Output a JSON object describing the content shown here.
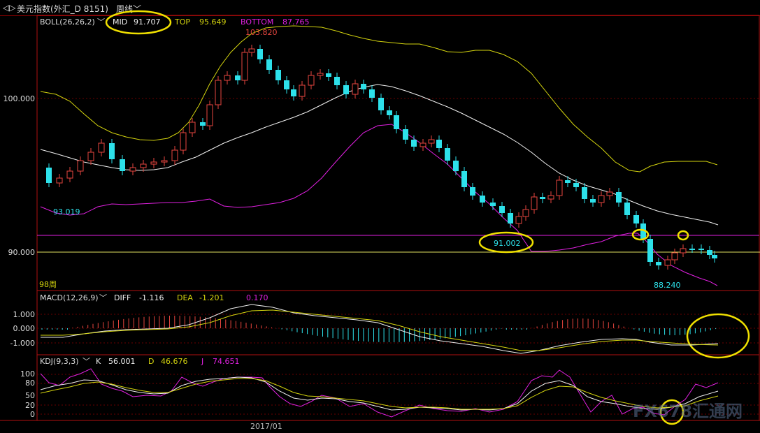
{
  "window": {
    "icon": "back-forward-icon",
    "instrument": "美元指数(外汇_D 8151)",
    "period": "周线"
  },
  "colors": {
    "up": "#e8463f",
    "down": "#2de1ea",
    "mid": "#f0f0f0",
    "top": "#d4d40e",
    "bottom": "#e020e0",
    "grid": "#7a0000",
    "axis": "#b01010"
  },
  "boll_panel": {
    "indicator": "BOLL(26,26,2)",
    "mid_label": "MID",
    "mid_value": "91.707",
    "top_label": "TOP",
    "top_value": "95.649",
    "bottom_label": "BOTTOM",
    "bottom_value": "87.765",
    "y_ticks": [
      "100.000",
      "90.000"
    ],
    "annotations": {
      "high": "103.820",
      "bottom_start": "93.019",
      "low_2017": "91.002",
      "low_recent": "88.240"
    },
    "bar_count": "98周"
  },
  "macd_panel": {
    "indicator": "MACD(12,26,9)",
    "diff_label": "DIFF",
    "diff_value": "-1.116",
    "dea_label": "DEA",
    "dea_value": "-1.201",
    "macd_value": "0.170",
    "y_ticks": [
      "1.000",
      "0.000",
      "-1.000"
    ]
  },
  "kdj_panel": {
    "indicator": "KDJ(9,3,3)",
    "k_label": "K",
    "k_value": "56.001",
    "d_label": "D",
    "d_value": "46.676",
    "j_label": "J",
    "j_value": "74.651",
    "y_ticks": [
      "100",
      "80",
      "50",
      "20",
      "0"
    ]
  },
  "x_axis": {
    "label": "2017/01"
  },
  "watermark": "FX678汇通网"
}
